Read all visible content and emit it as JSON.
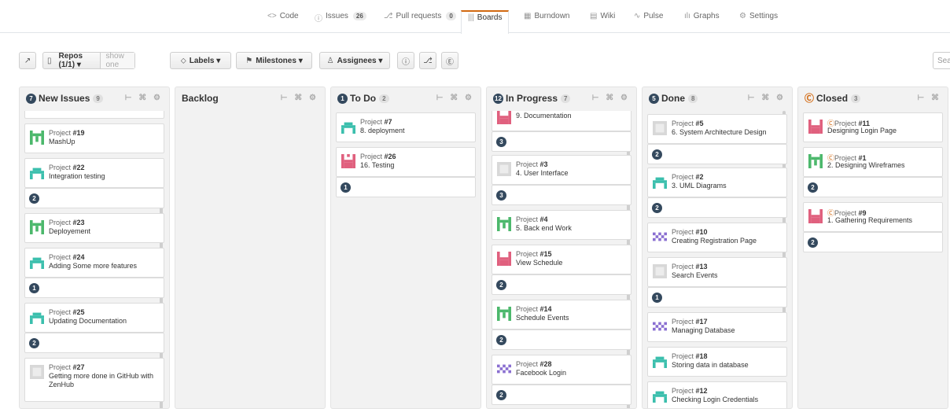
{
  "nav": {
    "tabs": [
      {
        "label": "Code",
        "icon": "code-icon",
        "glyph": "<>",
        "count": ""
      },
      {
        "label": "Issues",
        "icon": "issue-icon",
        "glyph": "ⓘ",
        "count": "26"
      },
      {
        "label": "Pull requests",
        "icon": "pull-request-icon",
        "glyph": "⎇",
        "count": "0"
      },
      {
        "label": "Boards",
        "icon": "boards-icon",
        "glyph": "|||",
        "count": ""
      },
      {
        "label": "Burndown",
        "icon": "burndown-icon",
        "glyph": "▦",
        "count": ""
      },
      {
        "label": "Wiki",
        "icon": "wiki-icon",
        "glyph": "▤",
        "count": ""
      },
      {
        "label": "Pulse",
        "icon": "pulse-icon",
        "glyph": "∿",
        "count": ""
      },
      {
        "label": "Graphs",
        "icon": "graphs-icon",
        "glyph": "ılı",
        "count": ""
      },
      {
        "label": "Settings",
        "icon": "gear-icon",
        "glyph": "⚙",
        "count": ""
      }
    ],
    "active": "Boards",
    "accent": "#d26911"
  },
  "toolbar": {
    "expand_glyph": "↗",
    "repos_label": "Repos (1/1) ▾",
    "show_one_label": "show one",
    "labels_label": "Labels ▾",
    "milestones_label": "Milestones ▾",
    "assignees_label": "Assignees ▾",
    "issue_glyph": "ⓘ",
    "pr_glyph": "⎇",
    "epic_glyph": "Ⓔ",
    "search_placeholder": "Sea"
  },
  "columns": [
    {
      "name": "New Issues",
      "dot": "7",
      "count": "9",
      "closed": false
    },
    {
      "name": "Backlog",
      "dot": "",
      "count": "",
      "closed": false
    },
    {
      "name": "To Do",
      "dot": "1",
      "count": "2",
      "closed": false
    },
    {
      "name": "In Progress",
      "dot": "12",
      "count": "7",
      "closed": false
    },
    {
      "name": "Done",
      "dot": "5",
      "count": "8",
      "closed": false
    },
    {
      "name": "Closed",
      "dot": "Ⓒ",
      "count": "3",
      "closed": true
    }
  ],
  "cards": {
    "new_issues": [
      {
        "project": "Project",
        "num": "#19",
        "title": "MashUp"
      },
      {
        "project": "Project",
        "num": "#22",
        "title": "Integration testing",
        "estimate": "2"
      },
      {
        "project": "Project",
        "num": "#23",
        "title": "Deployement"
      },
      {
        "project": "Project",
        "num": "#24",
        "title": "Adding Some more features",
        "estimate": "1"
      },
      {
        "project": "Project",
        "num": "#25",
        "title": "Updating Documentation",
        "estimate": "2"
      },
      {
        "project": "Project",
        "num": "#27",
        "title": "Getting more done in GitHub with ZenHub"
      }
    ],
    "todo": [
      {
        "project": "Project",
        "num": "#7",
        "title": "8. deployment"
      },
      {
        "project": "Project",
        "num": "#26",
        "title": "16. Testing",
        "estimate": "1"
      }
    ],
    "in_progress": [
      {
        "project": "",
        "num": "",
        "title": "9. Documentation",
        "estimate": "3"
      },
      {
        "project": "Project",
        "num": "#3",
        "title": "4. User Interface",
        "estimate": "3"
      },
      {
        "project": "Project",
        "num": "#4",
        "title": "5. Back end Work"
      },
      {
        "project": "Project",
        "num": "#15",
        "title": "View Schedule",
        "estimate": "2"
      },
      {
        "project": "Project",
        "num": "#14",
        "title": "Schedule Events",
        "estimate": "2"
      },
      {
        "project": "Project",
        "num": "#28",
        "title": "Facebook Login",
        "estimate": "2"
      }
    ],
    "done": [
      {
        "project": "Project",
        "num": "#5",
        "title": "6. System Architecture Design",
        "estimate": "2"
      },
      {
        "project": "Project",
        "num": "#2",
        "title": "3. UML Diagrams",
        "estimate": "2"
      },
      {
        "project": "Project",
        "num": "#10",
        "title": "Creating Registration Page"
      },
      {
        "project": "Project",
        "num": "#13",
        "title": "Search Events",
        "estimate": "1"
      },
      {
        "project": "Project",
        "num": "#17",
        "title": "Managing Database"
      },
      {
        "project": "Project",
        "num": "#18",
        "title": "Storing data in database"
      },
      {
        "project": "Project",
        "num": "#12",
        "title": "Checking Login Credentials"
      }
    ],
    "closed": [
      {
        "project": "Project",
        "num": "#11",
        "title": "Designing Login Page"
      },
      {
        "project": "Project",
        "num": "#1",
        "title": "2. Designing Wireframes",
        "estimate": "2"
      },
      {
        "project": "Project",
        "num": "#9",
        "title": "1. Gathering Requirements",
        "estimate": "2"
      }
    ]
  },
  "colors": {
    "estimate_badge": "#34495e",
    "column_bg": "#f2f2f2",
    "avatar_green": "#4cb86c",
    "avatar_teal": "#3bbfad",
    "avatar_pink": "#e0607e",
    "avatar_purple": "#8a6fd1",
    "avatar_gray": "#d8d8d8"
  }
}
